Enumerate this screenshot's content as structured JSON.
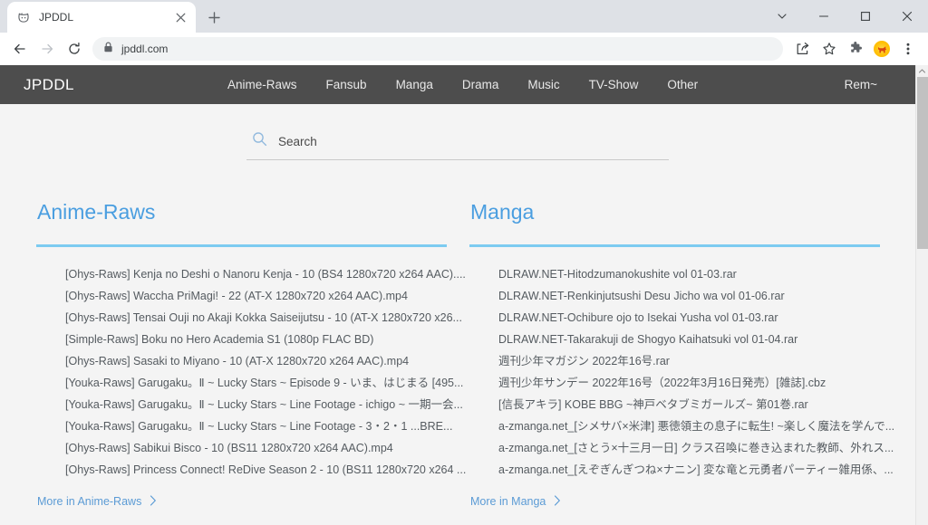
{
  "browser": {
    "tab": {
      "title": "JPDDL",
      "favicon_icon": "cat-favicon",
      "close_icon": "close-icon"
    },
    "new_tab_icon": "plus-icon",
    "window_controls": {
      "collapse_icon": "chevron-down-icon",
      "minimize_icon": "minimize-icon",
      "maximize_icon": "maximize-icon",
      "close_icon": "close-icon"
    },
    "toolbar": {
      "back_icon": "back-arrow-icon",
      "forward_icon": "forward-arrow-icon",
      "reload_icon": "reload-icon",
      "lock_icon": "lock-icon",
      "url": "jpddl.com",
      "share_icon": "share-icon",
      "bookmark_icon": "star-icon",
      "extensions_icon": "puzzle-icon",
      "extension_dog_icon": "dog-extension-icon",
      "menu_icon": "three-dot-menu-icon"
    }
  },
  "site": {
    "brand": "JPDDL",
    "nav_links": [
      {
        "label": "Anime-Raws"
      },
      {
        "label": "Fansub"
      },
      {
        "label": "Manga"
      },
      {
        "label": "Drama"
      },
      {
        "label": "Music"
      },
      {
        "label": "TV-Show"
      },
      {
        "label": "Other"
      }
    ],
    "user_menu": "Rem~",
    "search": {
      "icon": "search-icon",
      "placeholder": "Search",
      "value": ""
    },
    "sections": [
      {
        "title": "Anime-Raws",
        "more_label": "More in Anime-Raws",
        "more_chevron_icon": "chevron-right-icon",
        "items": [
          "[Ohys-Raws] Kenja no Deshi o Nanoru Kenja - 10 (BS4 1280x720 x264 AAC)....",
          "[Ohys-Raws] Waccha PriMagi! - 22 (AT-X 1280x720 x264 AAC).mp4",
          "[Ohys-Raws] Tensai Ouji no Akaji Kokka Saiseijutsu - 10 (AT-X 1280x720 x26...",
          "[Simple-Raws] Boku no Hero Academia S1 (1080p FLAC BD)",
          "[Ohys-Raws] Sasaki to Miyano - 10 (AT-X 1280x720 x264 AAC).mp4",
          "[Youka-Raws] Garugaku。Ⅱ ~ Lucky Stars ~ Episode 9 - いま、はじまる [495...",
          "[Youka-Raws] Garugaku。Ⅱ ~ Lucky Stars ~ Line Footage - ichigo ~ 一期一会...",
          "[Youka-Raws] Garugaku。Ⅱ ~ Lucky Stars ~ Line Footage - 3・2・1 ...BRE...",
          "[Ohys-Raws] Sabikui Bisco - 10 (BS11 1280x720 x264 AAC).mp4",
          "[Ohys-Raws] Princess Connect! ReDive Season 2 - 10 (BS11 1280x720 x264 ..."
        ]
      },
      {
        "title": "Manga",
        "more_label": "More in Manga",
        "more_chevron_icon": "chevron-right-icon",
        "items": [
          "DLRAW.NET-Hitodzumanokushite vol 01-03.rar",
          "DLRAW.NET-Renkinjutsushi Desu Jicho wa vol 01-06.rar",
          "DLRAW.NET-Ochibure ojo to Isekai Yusha vol 01-03.rar",
          "DLRAW.NET-Takarakuji de Shogyo Kaihatsuki vol 01-04.rar",
          "週刊少年マガジン 2022年16号.rar",
          "週刊少年サンデー 2022年16号（2022年3月16日発売）[雑誌].cbz",
          "[信長アキラ] KOBE BBG ~神戸ベタブミガールズ~ 第01巻.rar",
          "a-zmanga.net_[シメサバ×米津] 悪徳領主の息子に転生! ~楽しく魔法を学んで...",
          "a-zmanga.net_[さとう×十三月一日] クラス召喚に巻き込まれた教師、外れス...",
          "a-zmanga.net_[えぞぎんぎつね×ナニン] 変な竜と元勇者パーティー雑用係、..."
        ]
      }
    ]
  },
  "colors": {
    "nav_bg": "#4d4d4d",
    "heading": "#4a9ee0",
    "rule": "#7ccbf0",
    "link": "#5b9bd5",
    "page_bg": "#f4f4f4"
  }
}
